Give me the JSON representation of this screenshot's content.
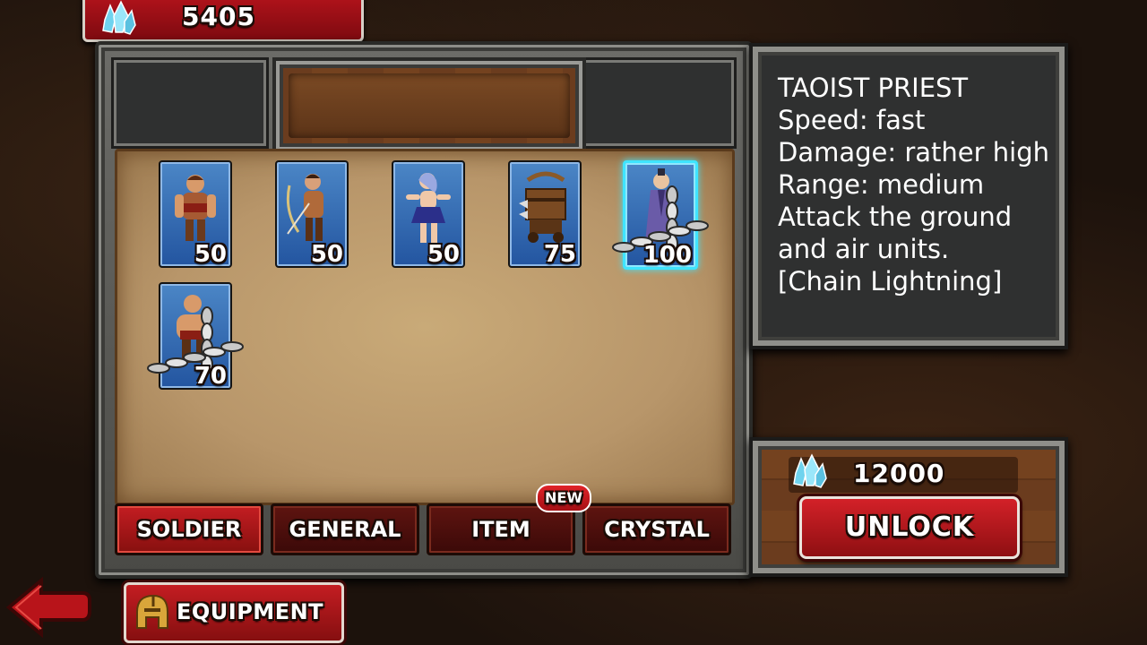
{
  "currency": {
    "crystals": "5405",
    "icon": "crystal-icon"
  },
  "panel": {
    "title": ""
  },
  "units": [
    {
      "name": "warrior",
      "cost": "50",
      "locked": false,
      "selected": false
    },
    {
      "name": "archer",
      "cost": "50",
      "locked": false,
      "selected": false
    },
    {
      "name": "dancer",
      "cost": "50",
      "locked": false,
      "selected": false
    },
    {
      "name": "ballista",
      "cost": "75",
      "locked": false,
      "selected": false
    },
    {
      "name": "taoist-priest",
      "cost": "100",
      "locked": true,
      "selected": true
    },
    {
      "name": "brute",
      "cost": "70",
      "locked": true,
      "selected": false
    }
  ],
  "tabs": [
    {
      "label": "SOLDIER",
      "active": true
    },
    {
      "label": "GENERAL",
      "active": false
    },
    {
      "label": "ITEM",
      "active": false,
      "badge": "NEW"
    },
    {
      "label": "CRYSTAL",
      "active": false
    }
  ],
  "info": {
    "title": "TAOIST PRIEST",
    "lines": [
      "Speed: fast",
      "Damage: rather high",
      "Range: medium",
      "Attack the ground",
      "and air units.",
      "[Chain Lightning]"
    ]
  },
  "unlock": {
    "price": "12000",
    "label": "UNLOCK"
  },
  "equipment": {
    "label": "EQUIPMENT"
  },
  "colors": {
    "accent_red": "#c41d22",
    "selected_glow": "#3fe4ff",
    "parchment": "#c9aa78"
  }
}
